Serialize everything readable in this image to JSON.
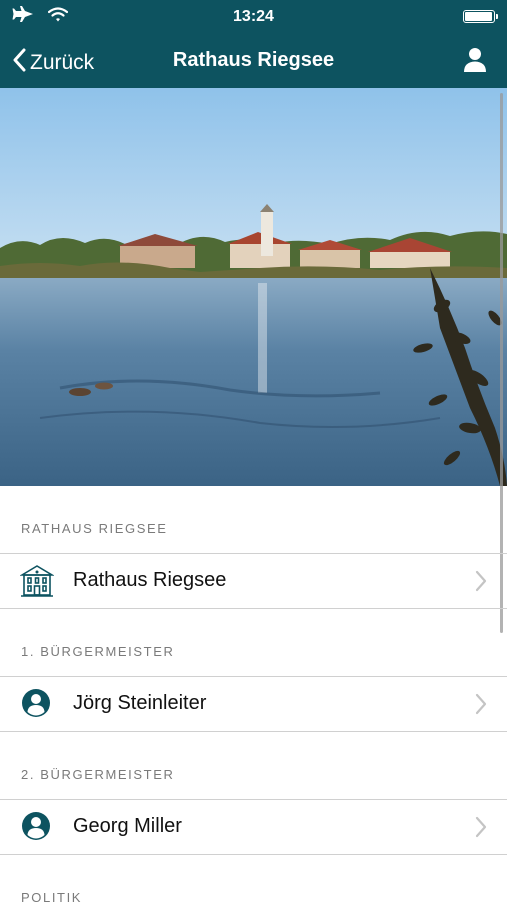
{
  "status_bar": {
    "time": "13:24",
    "icons": [
      "airplane-icon",
      "wifi-icon",
      "battery-icon"
    ]
  },
  "nav": {
    "back_label": "Zurück",
    "title": "Rathaus Riegsee",
    "right_icon": "user-icon"
  },
  "colors": {
    "header_bg": "#0d5360",
    "accent": "#0d5360",
    "section_text": "#7a7a7a",
    "separator": "#d0d0d0"
  },
  "sections": [
    {
      "header": "RATHAUS RIEGSEE",
      "item": {
        "label": "Rathaus Riegsee",
        "icon": "town-hall-icon"
      }
    },
    {
      "header": "1. BÜRGERMEISTER",
      "item": {
        "label": "Jörg Steinleiter",
        "icon": "person-icon"
      }
    },
    {
      "header": "2. BÜRGERMEISTER",
      "item": {
        "label": "Georg Miller",
        "icon": "person-icon"
      }
    },
    {
      "header": "POLITIK"
    }
  ]
}
